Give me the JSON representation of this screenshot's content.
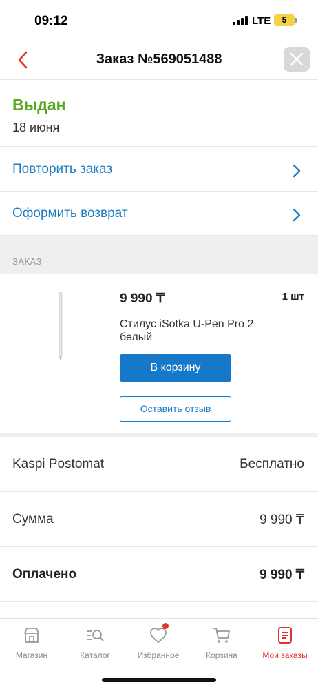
{
  "status_bar": {
    "time": "09:12",
    "network": "LTE",
    "battery": "5"
  },
  "header": {
    "title": "Заказ №569051488"
  },
  "order_status": {
    "title": "Выдан",
    "date": "18 июня"
  },
  "actions": [
    {
      "label": "Повторить заказ"
    },
    {
      "label": "Оформить возврат"
    }
  ],
  "section_label": "ЗАКАЗ",
  "product": {
    "price": "9 990 ₸",
    "quantity": "1 шт",
    "name": "Стилус iSotka U-Pen Pro 2 белый",
    "cart_button": "В корзину",
    "review_button": "Оставить отзыв"
  },
  "summary": [
    {
      "key": "Kaspi Postomat",
      "value": "Бесплатно"
    },
    {
      "key": "Сумма",
      "value": "9 990 ₸"
    },
    {
      "key": "Оплачено",
      "value": "9 990 ₸"
    }
  ],
  "tabs": [
    {
      "label": "Магазин",
      "icon": "shop-icon"
    },
    {
      "label": "Каталог",
      "icon": "catalog-search-icon"
    },
    {
      "label": "Избранное",
      "icon": "heart-icon"
    },
    {
      "label": "Корзина",
      "icon": "cart-icon"
    },
    {
      "label": "Мои заказы",
      "icon": "orders-icon"
    }
  ],
  "colors": {
    "accent_blue": "#1578c8",
    "status_green": "#56a81e",
    "active_red": "#e0332e"
  }
}
